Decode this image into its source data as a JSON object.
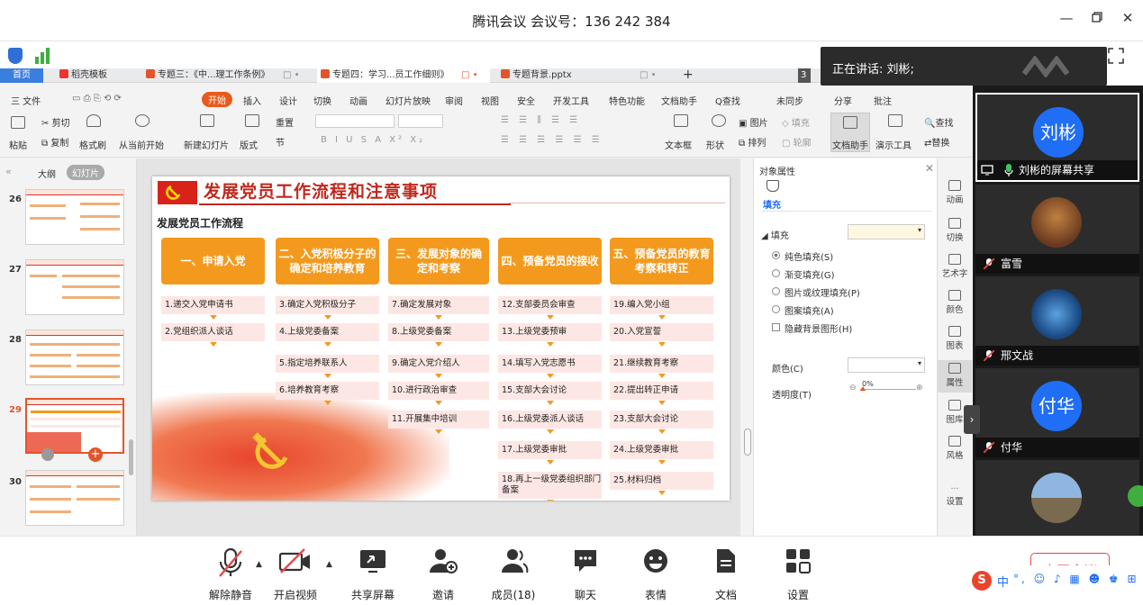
{
  "meeting": {
    "title": "腾讯会议 会议号：136 242 384"
  },
  "speaking": {
    "text": "正在讲话: 刘彬;"
  },
  "wps": {
    "tabs": [
      {
        "label": "首页"
      },
      {
        "label": "稻壳模板"
      },
      {
        "label": "专题三：《中...理工作条例》"
      },
      {
        "label": "专题四：学习...员工作细则》"
      },
      {
        "label": "专题背景.pptx"
      }
    ],
    "tab_count": "3",
    "menu": [
      "三 文件",
      "开始",
      "插入",
      "设计",
      "切换",
      "动画",
      "幻灯片放映",
      "审阅",
      "视图",
      "安全",
      "开发工具",
      "特色功能",
      "文档助手",
      "Q查找"
    ],
    "menu_right": [
      "未同步",
      "分享",
      "批注"
    ],
    "ribbon": {
      "paste": "粘贴",
      "cut": "剪切",
      "copy": "复制",
      "format_painter": "格式刷",
      "from_current": "从当前开始",
      "new_slide": "新建幻灯片",
      "layout": "版式",
      "section": "节",
      "reset": "重置",
      "textbox": "文本框",
      "shape": "形状",
      "picture": "图片",
      "fill": "填充",
      "arrange": "排列",
      "outline": "轮廓",
      "doc_helper": "文档助手",
      "present_tool": "演示工具",
      "find": "查找",
      "replace": "替换"
    },
    "panel_tabs": {
      "outline": "大纲",
      "slides": "幻灯片"
    },
    "slide_numbers": [
      "26",
      "27",
      "28",
      "29",
      "30"
    ],
    "slide": {
      "title": "发展党员工作流程和注意事项",
      "subtitle": "发展党员工作流程",
      "columns": [
        {
          "head": "一、申请入党",
          "steps": [
            "1.递交入党申请书",
            "2.党组织派人谈话"
          ]
        },
        {
          "head": "二、入党积极分子的确定和培养教育",
          "steps": [
            "3.确定入党积极分子",
            "4.上级党委备案",
            "5.指定培养联系人",
            "6.培养教育考察"
          ]
        },
        {
          "head": "三、发展对象的确定和考察",
          "steps": [
            "7.确定发展对象",
            "8.上级党委备案",
            "9.确定入党介绍人",
            "10.进行政治审查",
            "11.开展集中培训"
          ]
        },
        {
          "head": "四、预备党员的接收",
          "steps": [
            "12.支部委员会审查",
            "13.上级党委预审",
            "14.填写入党志愿书",
            "15.支部大会讨论",
            "16.上级党委派人谈话",
            "17.上级党委审批",
            "18.再上一级党委组织部门备案"
          ]
        },
        {
          "head": "五、预备党员的教育考察和转正",
          "steps": [
            "19.编入党小组",
            "20.入党宣誓",
            "21.继续教育考察",
            "22.提出转正申请",
            "23.支部大会讨论",
            "24.上级党委审批",
            "25.材料归档"
          ]
        }
      ]
    },
    "properties": {
      "header": "对象属性",
      "tab": "填充",
      "section": "填充",
      "options": [
        "纯色填充(S)",
        "渐变填充(G)",
        "图片或纹理填充(P)",
        "图案填充(A)",
        "隐藏背景图形(H)"
      ],
      "color_label": "颜色(C)",
      "transparency_label": "透明度(T)",
      "transparency_value": "0%"
    },
    "sidebar": [
      "动画",
      "切换",
      "艺术字",
      "颜色",
      "图表",
      "属性",
      "图库",
      "风格",
      "设置"
    ]
  },
  "participants": [
    {
      "name": "刘彬的屏幕共享",
      "avatar_text": "刘彬",
      "avatar_color": "#1f6ef5"
    },
    {
      "name": "富雪"
    },
    {
      "name": "邢文战"
    },
    {
      "name": "付华",
      "avatar_text": "付华",
      "avatar_color": "#1f6ef5"
    }
  ],
  "toolbar": {
    "unmute": "解除静音",
    "video": "开启视频",
    "share": "共享屏幕",
    "invite": "邀请",
    "members": "成员(18)",
    "chat": "聊天",
    "emoji": "表情",
    "docs": "文档",
    "settings": "设置",
    "leave": "离开会议"
  },
  "ime": {
    "label": "中"
  }
}
